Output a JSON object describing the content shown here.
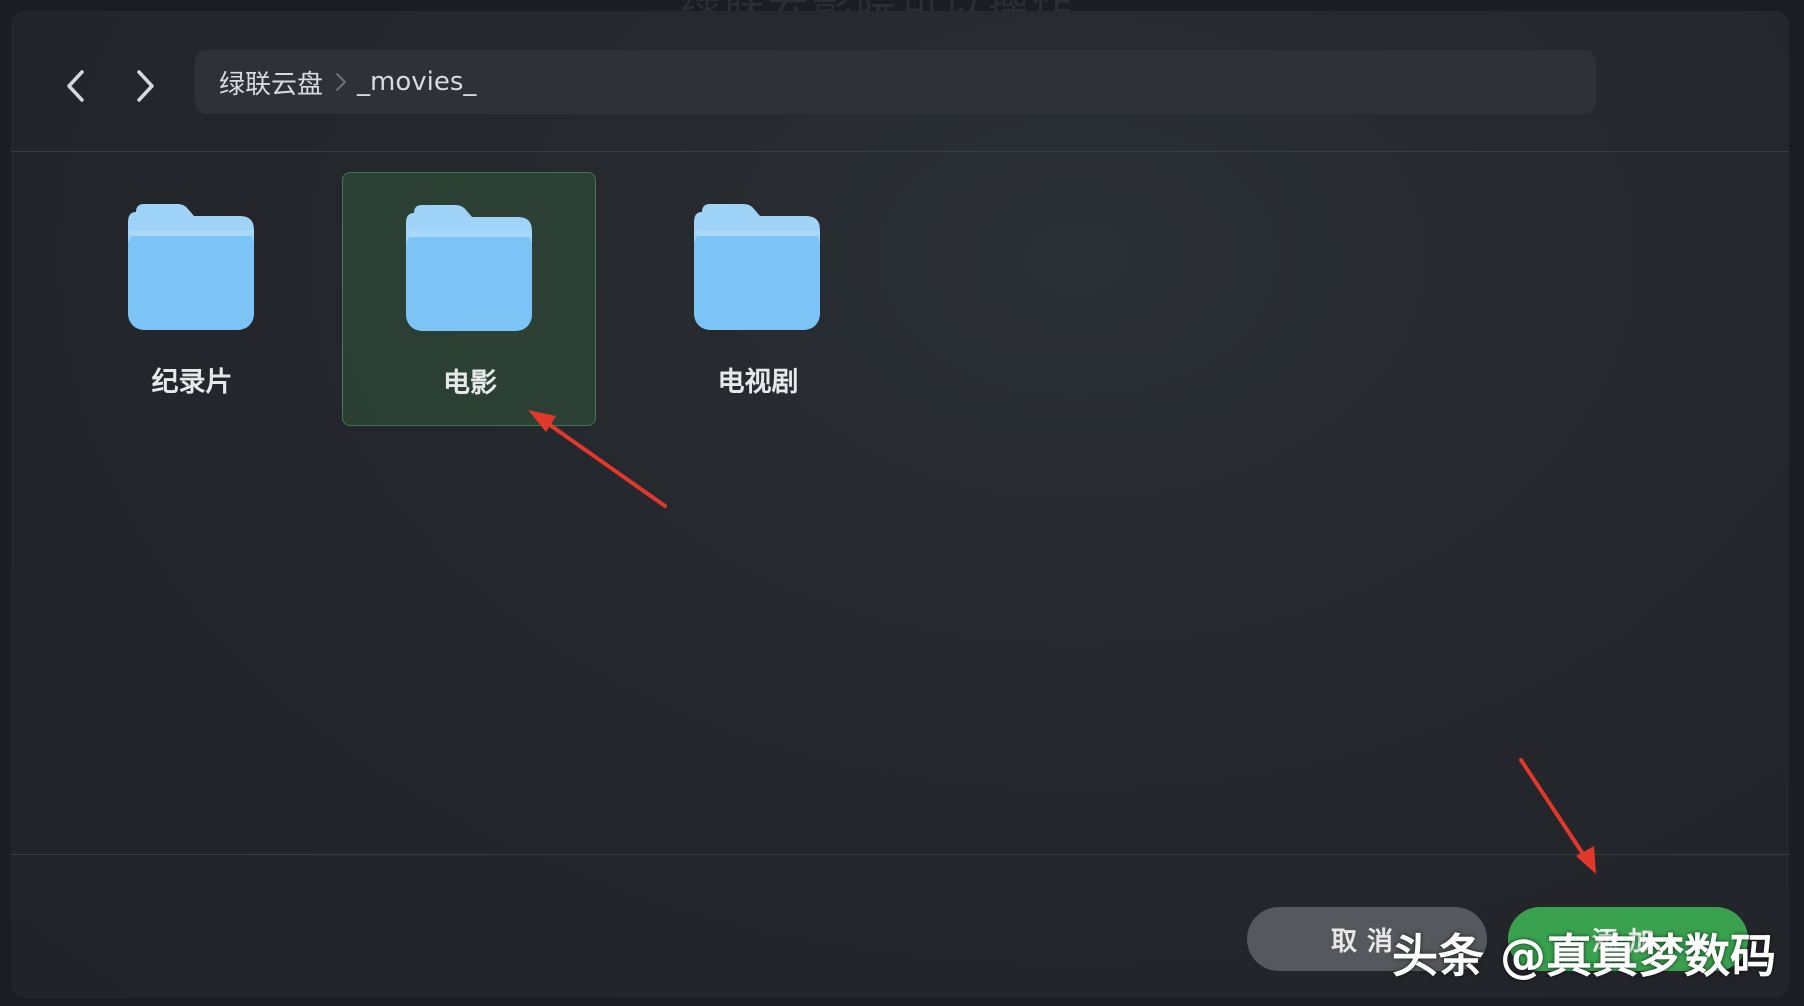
{
  "background_title": "绿联云影院可以操作",
  "breadcrumb": {
    "items": [
      "绿联云盘",
      "_movies_"
    ]
  },
  "nav": {
    "back_icon": "chevron-left-icon",
    "forward_icon": "chevron-right-icon"
  },
  "folders": [
    {
      "label": "纪录片",
      "selected": false,
      "icon": "folder-icon"
    },
    {
      "label": "电影",
      "selected": true,
      "icon": "folder-icon"
    },
    {
      "label": "电视剧",
      "selected": false,
      "icon": "folder-icon"
    }
  ],
  "footer": {
    "cancel_label": "取消",
    "add_label": "添加"
  },
  "watermark": "头条 @真真梦数码",
  "colors": {
    "accent_green": "#3aa24f",
    "selection_bg": "#2f4a37",
    "folder_blue": "#7cc4f5",
    "annotation_red": "#e0382b"
  }
}
